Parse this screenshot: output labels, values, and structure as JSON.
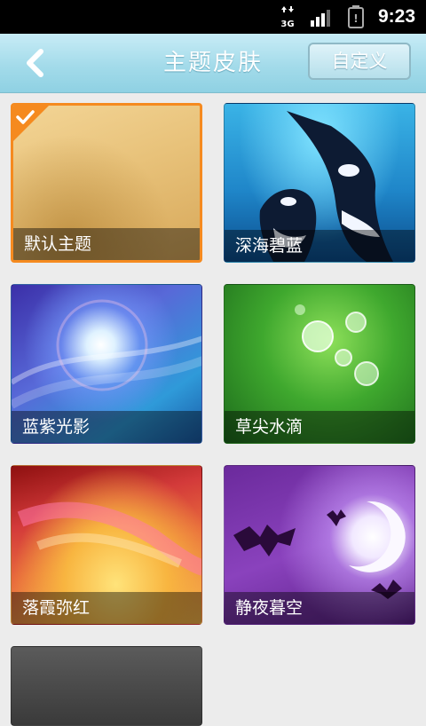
{
  "status_bar": {
    "network": "3G",
    "time": "9:23"
  },
  "header": {
    "title": "主题皮肤",
    "custom_label": "自定义"
  },
  "themes": [
    {
      "label": "默认主题",
      "selected": true
    },
    {
      "label": "深海碧蓝",
      "selected": false
    },
    {
      "label": "蓝紫光影",
      "selected": false
    },
    {
      "label": "草尖水滴",
      "selected": false
    },
    {
      "label": "落霞弥红",
      "selected": false
    },
    {
      "label": "静夜暮空",
      "selected": false
    },
    {
      "label": "",
      "selected": false
    }
  ],
  "colors": {
    "header_bg": "#a3dbea",
    "selected_border": "#f58a1f"
  }
}
